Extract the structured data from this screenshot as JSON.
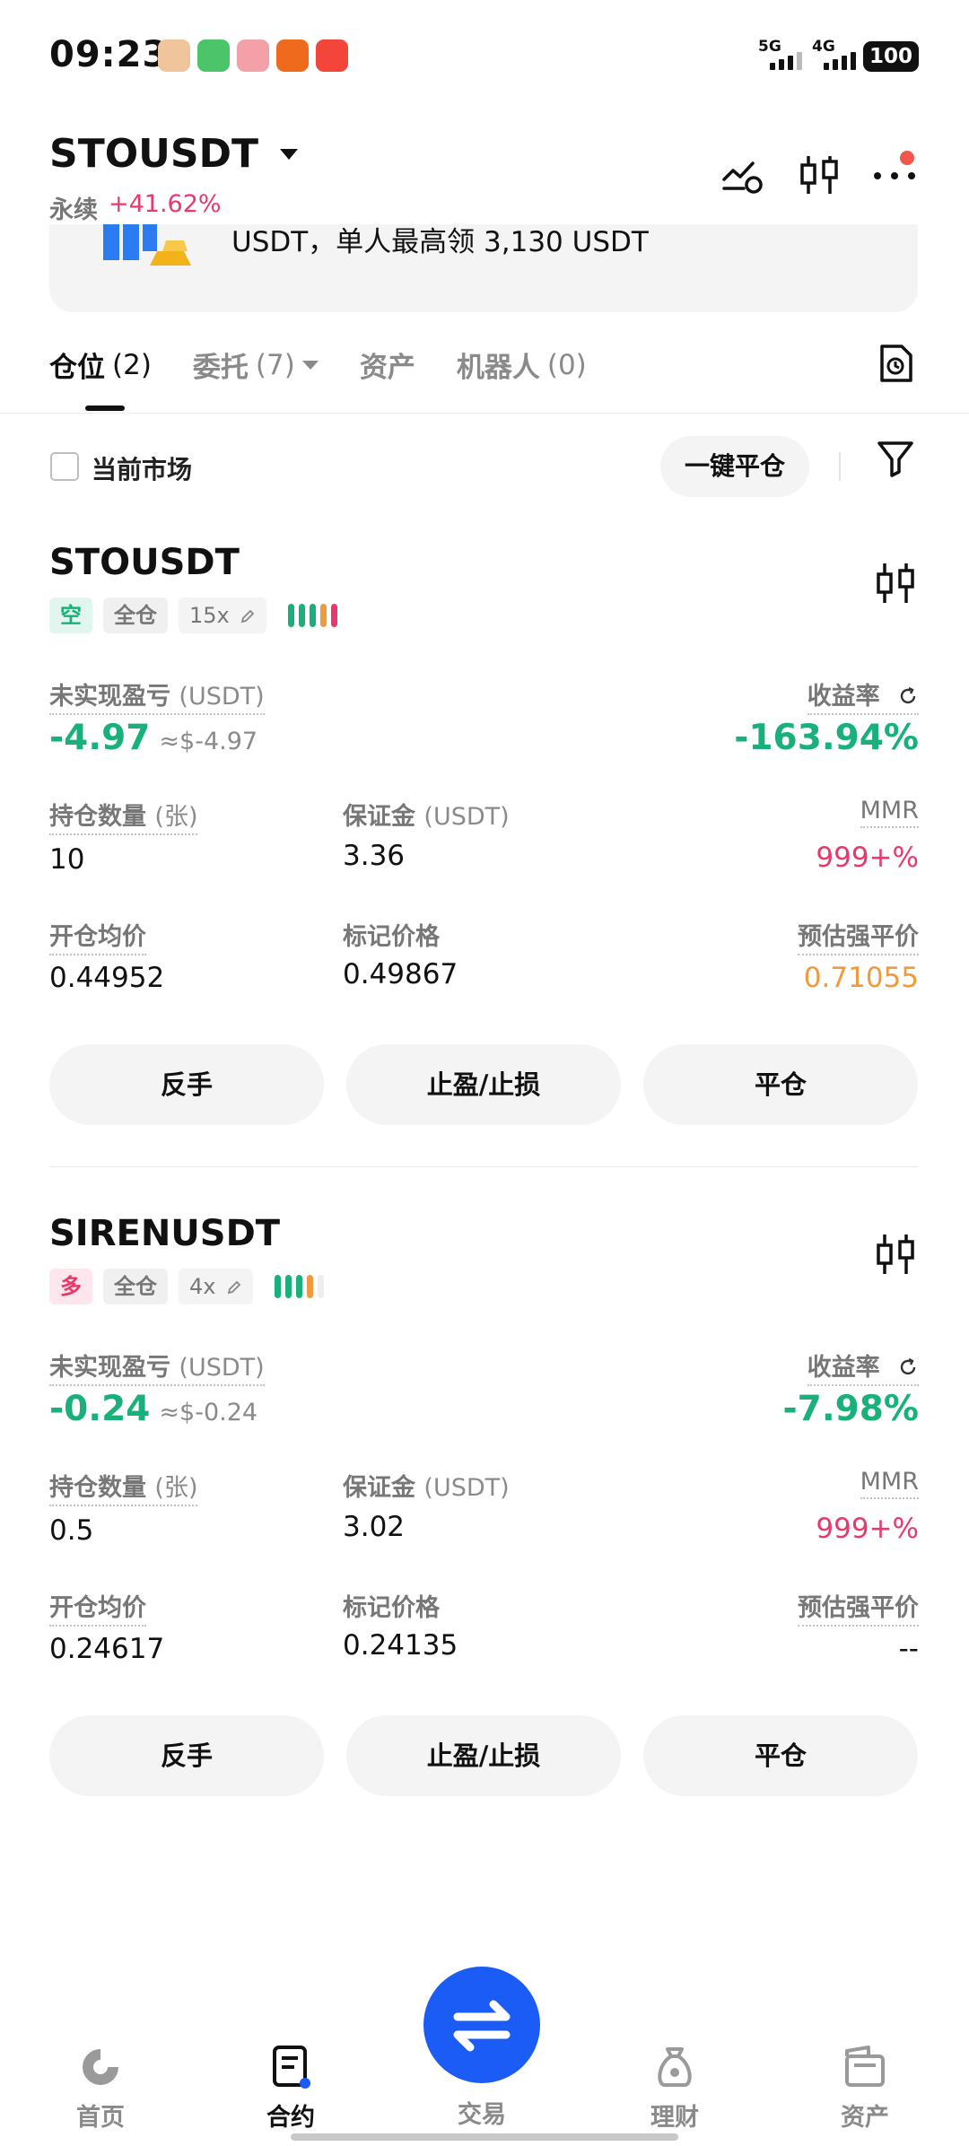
{
  "status_bar": {
    "time": "09:23",
    "signal_1": "5G",
    "signal_2": "4G",
    "battery": "100"
  },
  "header": {
    "pair": "STOUSDT",
    "contract_type": "永续",
    "change": "+41.62%"
  },
  "banner": {
    "text": "USDT，单人最高领 3,130 USDT"
  },
  "tabs": [
    {
      "label": "仓位",
      "count": "(2)"
    },
    {
      "label": "委托",
      "count": "(7)"
    },
    {
      "label": "资产",
      "count": ""
    },
    {
      "label": "机器人",
      "count": "(0)"
    }
  ],
  "filter": {
    "current_market": "当前市场",
    "close_all": "一键平仓"
  },
  "labels": {
    "unrealized_pnl": "未实现盈亏",
    "unit_usdt": "(USDT)",
    "roe": "收益率",
    "quantity": "持仓数量",
    "quantity_unit": "(张)",
    "margin": "保证金",
    "mmr": "MMR",
    "entry_price": "开仓均价",
    "mark_price": "标记价格",
    "liq_price": "预估强平价",
    "reverse": "反手",
    "tp_sl": "止盈/止损",
    "close": "平仓"
  },
  "positions": [
    {
      "symbol": "STOUSDT",
      "side": "空",
      "mode": "全仓",
      "leverage": "15x",
      "pnl": "-4.97",
      "pnl_usd": "≈$-4.97",
      "roe": "-163.94%",
      "quantity": "10",
      "margin": "3.36",
      "mmr": "999+%",
      "entry_price": "0.44952",
      "mark_price": "0.49867",
      "liq_price": "0.71055"
    },
    {
      "symbol": "SIRENUSDT",
      "side": "多",
      "mode": "全仓",
      "leverage": "4x",
      "pnl": "-0.24",
      "pnl_usd": "≈$-0.24",
      "roe": "-7.98%",
      "quantity": "0.5",
      "margin": "3.02",
      "mmr": "999+%",
      "entry_price": "0.24617",
      "mark_price": "0.24135",
      "liq_price": "--"
    }
  ],
  "bottom_nav": {
    "home": "首页",
    "futures": "合约",
    "trade": "交易",
    "earn": "理财",
    "assets": "资产"
  },
  "colors": {
    "green": "#1ab07a",
    "red": "#e8386c",
    "orange": "#f09a3e",
    "accent": "#1a5cf5"
  }
}
